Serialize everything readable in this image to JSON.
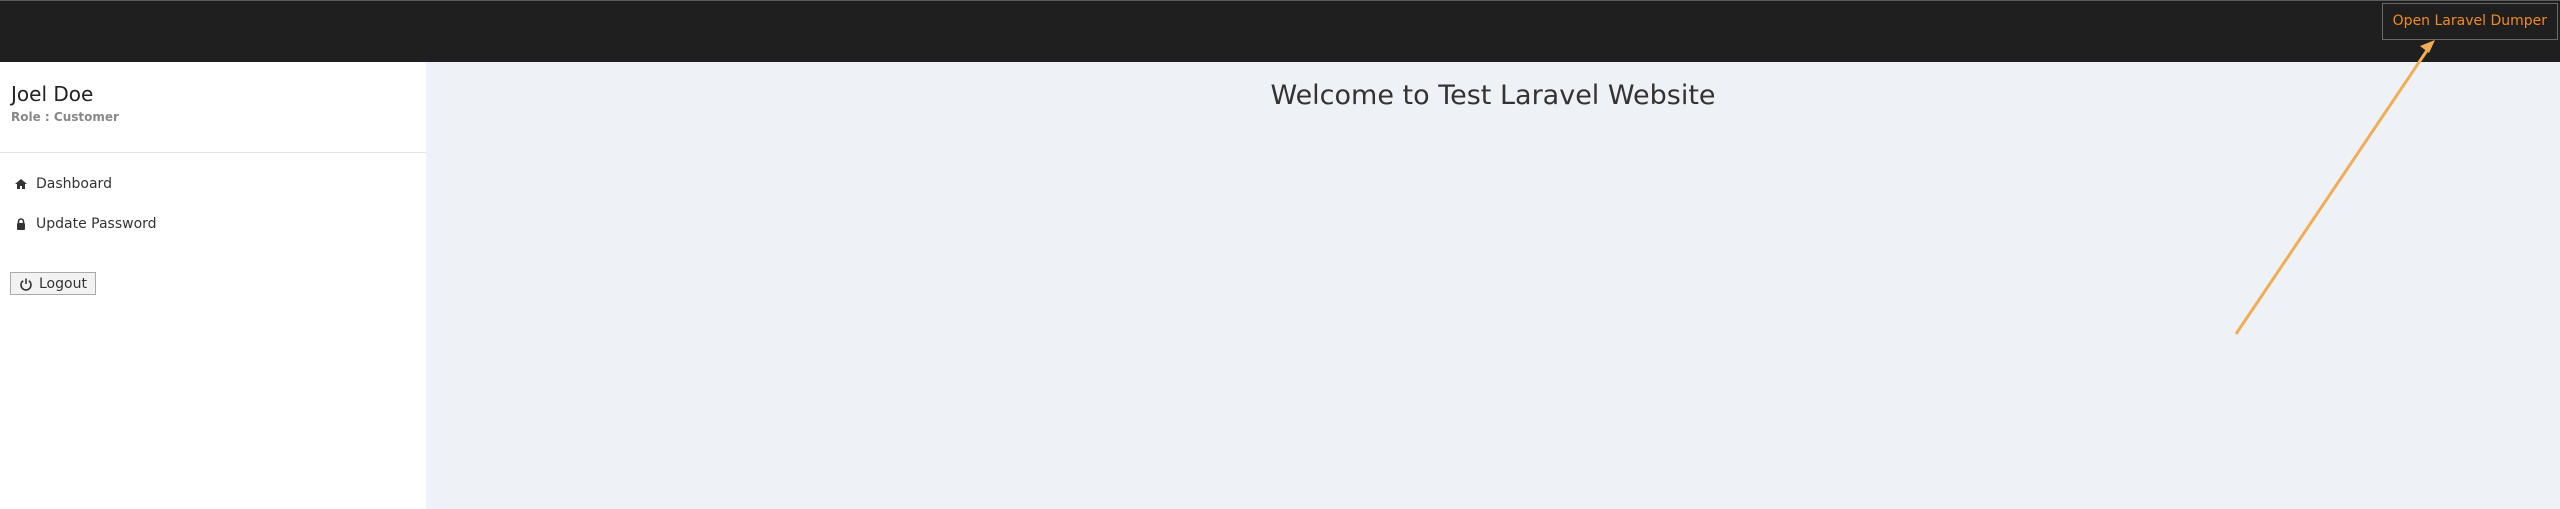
{
  "topbar": {
    "dumper_button": "Open Laravel Dumper"
  },
  "sidebar": {
    "user_name": "Joel Doe",
    "user_role": "Role : Customer",
    "items": [
      {
        "label": "Dashboard",
        "icon": "home-icon"
      },
      {
        "label": "Update Password",
        "icon": "lock-icon"
      }
    ],
    "logout_label": "Logout"
  },
  "main": {
    "welcome": "Welcome to Test Laravel Website"
  },
  "colors": {
    "topbar": "#1f1f1f",
    "accent": "#f08a24",
    "arrow": "#f0ad57",
    "sidebar": "#ffffff",
    "main": "#eef1f6"
  }
}
